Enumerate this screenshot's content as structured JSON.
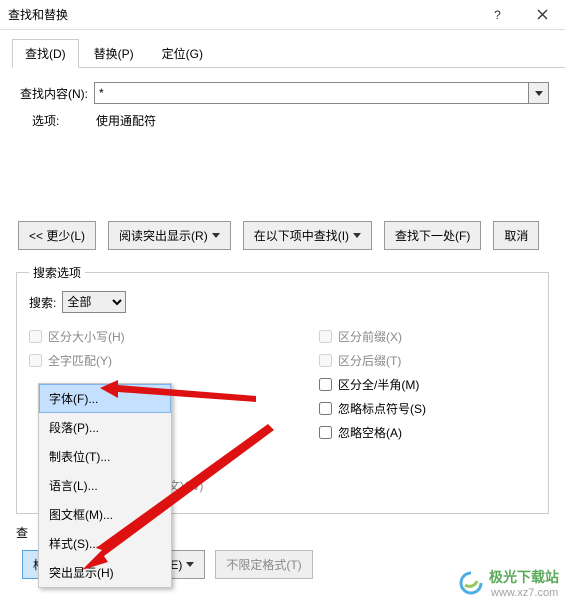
{
  "titlebar": {
    "title": "查找和替换"
  },
  "tabs": {
    "find": "查找(D)",
    "replace": "替换(P)",
    "goto": "定位(G)"
  },
  "find": {
    "content_label": "查找内容(N):",
    "content_value": "*",
    "option_label": "选项:",
    "option_value": "使用通配符"
  },
  "buttons": {
    "less": "<< 更少(L)",
    "highlight": "阅读突出显示(R)",
    "find_in": "在以下项中查找(I)",
    "find_next": "查找下一处(F)",
    "cancel": "取消"
  },
  "search_options": {
    "legend": "搜索选项",
    "search_label": "搜索:",
    "search_value": "全部",
    "match_case": "区分大小写(H)",
    "whole_word": "全字匹配(Y)",
    "sounds_like": "文)(W)",
    "prefix": "区分前缀(X)",
    "suffix": "区分后缀(T)",
    "width": "区分全/半角(M)",
    "ignore_punc": "忽略标点符号(S)",
    "ignore_space": "忽略空格(A)"
  },
  "format_menu": {
    "font": "字体(F)...",
    "paragraph": "段落(P)...",
    "tabs": "制表位(T)...",
    "language": "语言(L)...",
    "frame": "图文框(M)...",
    "style": "样式(S)...",
    "highlight": "突出显示(H)"
  },
  "bottom": {
    "replace_group": "查",
    "format_btn": "格式(O)",
    "special_btn": "特殊格式(E)",
    "noformat_btn": "不限定格式(T)"
  },
  "watermark": {
    "text": "极光下载站",
    "url": "www.xz7.com"
  }
}
